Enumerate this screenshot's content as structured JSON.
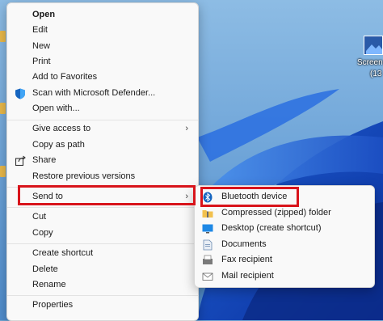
{
  "desktop": {
    "icon_label_top": "Screen",
    "icon_label_bottom": "(13"
  },
  "context_menu": {
    "items": [
      {
        "label": "Open"
      },
      {
        "label": "Edit"
      },
      {
        "label": "New"
      },
      {
        "label": "Print"
      },
      {
        "label": "Add to Favorites"
      },
      {
        "label": "Scan with Microsoft Defender..."
      },
      {
        "label": "Open with..."
      },
      {
        "label": "Give access to"
      },
      {
        "label": "Copy as path"
      },
      {
        "label": "Share"
      },
      {
        "label": "Restore previous versions"
      },
      {
        "label": "Send to"
      },
      {
        "label": "Cut"
      },
      {
        "label": "Copy"
      },
      {
        "label": "Create shortcut"
      },
      {
        "label": "Delete"
      },
      {
        "label": "Rename"
      },
      {
        "label": "Properties"
      }
    ],
    "chevron": "›"
  },
  "send_to_menu": {
    "items": [
      {
        "label": "Bluetooth device",
        "icon": "bluetooth-icon"
      },
      {
        "label": "Compressed (zipped) folder",
        "icon": "zip-folder-icon"
      },
      {
        "label": "Desktop (create shortcut)",
        "icon": "desktop-icon"
      },
      {
        "label": "Documents",
        "icon": "documents-icon"
      },
      {
        "label": "Fax recipient",
        "icon": "fax-icon"
      },
      {
        "label": "Mail recipient",
        "icon": "mail-icon"
      }
    ]
  },
  "colors": {
    "highlight_border": "#d8141b",
    "menu_background": "#f9f9f9",
    "wallpaper": "#6fa6d3"
  }
}
